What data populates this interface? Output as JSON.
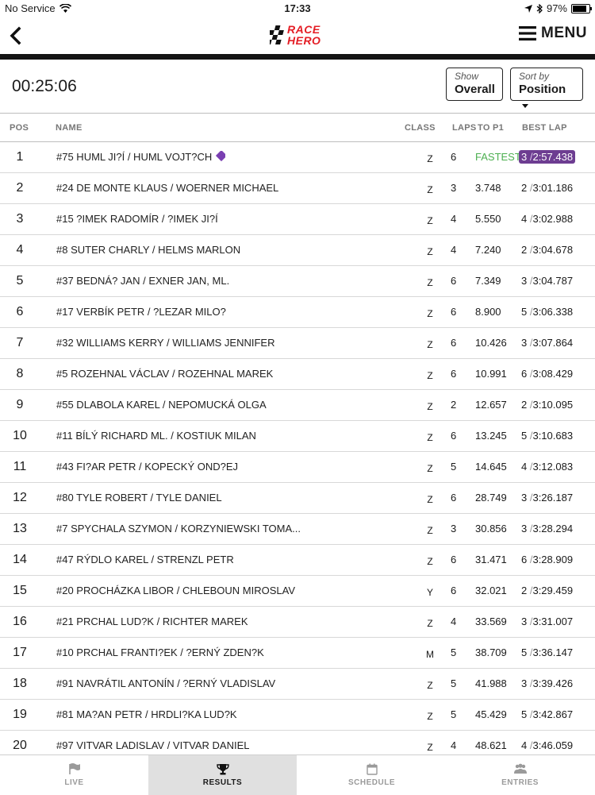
{
  "status_bar": {
    "carrier": "No Service",
    "time": "17:33",
    "battery": "97%",
    "battery_level": 0.97
  },
  "nav": {
    "logo_text_1": "RACE",
    "logo_text_2": "HERO",
    "menu_label": "MENU",
    "icons": {
      "back": "chevron-left-icon",
      "menu": "hamburger-icon"
    }
  },
  "controls": {
    "elapsed_time": "00:25:06",
    "show_caption": "Show",
    "show_value": "Overall",
    "sort_caption": "Sort by",
    "sort_value": "Position"
  },
  "columns": {
    "pos": "POS",
    "name": "NAME",
    "class": "CLASS",
    "laps": "LAPS",
    "gap": "TO P1",
    "best": "BEST LAP"
  },
  "rows": [
    {
      "pos": "1",
      "name": "#75 HUML JI?Í / HUML VOJT?CH",
      "class": "Z",
      "laps": "6",
      "gap": "FASTEST!",
      "best_lap": "3",
      "best_time": "2:57.438"
    },
    {
      "pos": "2",
      "name": "#24 DE MONTE KLAUS / WOERNER MICHAEL",
      "class": "Z",
      "laps": "3",
      "gap": "3.748",
      "best_lap": "2",
      "best_time": "3:01.186"
    },
    {
      "pos": "3",
      "name": "#15 ?IMEK RADOMÍR / ?IMEK JI?Í",
      "class": "Z",
      "laps": "4",
      "gap": "5.550",
      "best_lap": "4",
      "best_time": "3:02.988"
    },
    {
      "pos": "4",
      "name": "#8 SUTER CHARLY / HELMS MARLON",
      "class": "Z",
      "laps": "4",
      "gap": "7.240",
      "best_lap": "2",
      "best_time": "3:04.678"
    },
    {
      "pos": "5",
      "name": "#37 BEDNÁ? JAN / EXNER JAN, ML.",
      "class": "Z",
      "laps": "6",
      "gap": "7.349",
      "best_lap": "3",
      "best_time": "3:04.787"
    },
    {
      "pos": "6",
      "name": "#17 VERBÍK PETR / ?LEZAR MILO?",
      "class": "Z",
      "laps": "6",
      "gap": "8.900",
      "best_lap": "5",
      "best_time": "3:06.338"
    },
    {
      "pos": "7",
      "name": "#32 WILLIAMS KERRY / WILLIAMS JENNIFER",
      "class": "Z",
      "laps": "6",
      "gap": "10.426",
      "best_lap": "3",
      "best_time": "3:07.864"
    },
    {
      "pos": "8",
      "name": "#5 ROZEHNAL VÁCLAV / ROZEHNAL MAREK",
      "class": "Z",
      "laps": "6",
      "gap": "10.991",
      "best_lap": "6",
      "best_time": "3:08.429"
    },
    {
      "pos": "9",
      "name": "#55 DLABOLA KAREL / NEPOMUCKÁ OLGA",
      "class": "Z",
      "laps": "2",
      "gap": "12.657",
      "best_lap": "2",
      "best_time": "3:10.095"
    },
    {
      "pos": "10",
      "name": "#11 BÍLÝ RICHARD ML. / KOSTIUK MILAN",
      "class": "Z",
      "laps": "6",
      "gap": "13.245",
      "best_lap": "5",
      "best_time": "3:10.683"
    },
    {
      "pos": "11",
      "name": "#43 FI?AR PETR / KOPECKÝ OND?EJ",
      "class": "Z",
      "laps": "5",
      "gap": "14.645",
      "best_lap": "4",
      "best_time": "3:12.083"
    },
    {
      "pos": "12",
      "name": "#80 TYLE ROBERT / TYLE DANIEL",
      "class": "Z",
      "laps": "6",
      "gap": "28.749",
      "best_lap": "3",
      "best_time": "3:26.187"
    },
    {
      "pos": "13",
      "name": "#7 SPYCHALA SZYMON / KORZYNIEWSKI TOMA...",
      "class": "Z",
      "laps": "3",
      "gap": "30.856",
      "best_lap": "3",
      "best_time": "3:28.294"
    },
    {
      "pos": "14",
      "name": "#47 RÝDLO KAREL / STRENZL PETR",
      "class": "Z",
      "laps": "6",
      "gap": "31.471",
      "best_lap": "6",
      "best_time": "3:28.909"
    },
    {
      "pos": "15",
      "name": "#20 PROCHÁZKA LIBOR / CHLEBOUN MIROSLAV",
      "class": "Y",
      "laps": "6",
      "gap": "32.021",
      "best_lap": "2",
      "best_time": "3:29.459"
    },
    {
      "pos": "16",
      "name": "#21 PRCHAL LUD?K / RICHTER MAREK",
      "class": "Z",
      "laps": "4",
      "gap": "33.569",
      "best_lap": "3",
      "best_time": "3:31.007"
    },
    {
      "pos": "17",
      "name": "#10 PRCHAL FRANTI?EK / ?ERNÝ ZDEN?K",
      "class": "M",
      "laps": "5",
      "gap": "38.709",
      "best_lap": "5",
      "best_time": "3:36.147"
    },
    {
      "pos": "18",
      "name": "#91 NAVRÁTIL ANTONÍN / ?ERNÝ VLADISLAV",
      "class": "Z",
      "laps": "5",
      "gap": "41.988",
      "best_lap": "3",
      "best_time": "3:39.426"
    },
    {
      "pos": "19",
      "name": "#81 MA?AN PETR / HRDLI?KA LUD?K",
      "class": "Z",
      "laps": "5",
      "gap": "45.429",
      "best_lap": "5",
      "best_time": "3:42.867"
    },
    {
      "pos": "20",
      "name": "#97 VITVAR LADISLAV / VITVAR DANIEL",
      "class": "Z",
      "laps": "4",
      "gap": "48.621",
      "best_lap": "4",
      "best_time": "3:46.059"
    }
  ],
  "tabs": [
    {
      "label": "LIVE",
      "icon": "flag-icon",
      "active": false
    },
    {
      "label": "RESULTS",
      "icon": "trophy-icon",
      "active": true
    },
    {
      "label": "SCHEDULE",
      "icon": "calendar-icon",
      "active": false
    },
    {
      "label": "ENTRIES",
      "icon": "people-icon",
      "active": false
    }
  ],
  "colors": {
    "accent_red": "#e41e26",
    "fastest_green": "#4caf50",
    "best_lap_purple": "#6d3d91"
  }
}
